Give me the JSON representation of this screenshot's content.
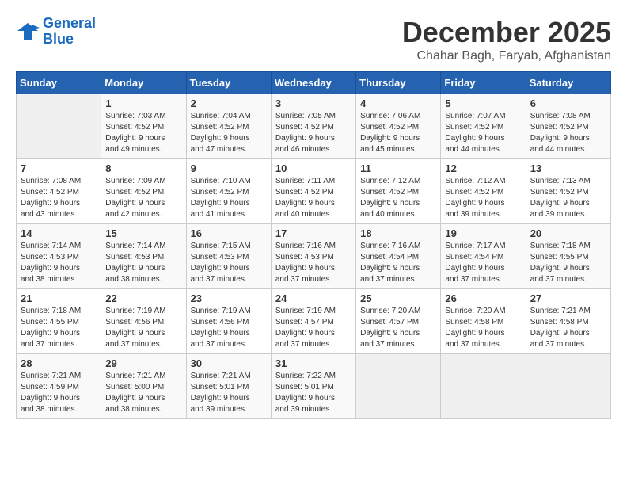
{
  "logo": {
    "line1": "General",
    "line2": "Blue"
  },
  "title": "December 2025",
  "subtitle": "Chahar Bagh, Faryab, Afghanistan",
  "days_header": [
    "Sunday",
    "Monday",
    "Tuesday",
    "Wednesday",
    "Thursday",
    "Friday",
    "Saturday"
  ],
  "weeks": [
    [
      {
        "day": "",
        "info": ""
      },
      {
        "day": "1",
        "info": "Sunrise: 7:03 AM\nSunset: 4:52 PM\nDaylight: 9 hours\nand 49 minutes."
      },
      {
        "day": "2",
        "info": "Sunrise: 7:04 AM\nSunset: 4:52 PM\nDaylight: 9 hours\nand 47 minutes."
      },
      {
        "day": "3",
        "info": "Sunrise: 7:05 AM\nSunset: 4:52 PM\nDaylight: 9 hours\nand 46 minutes."
      },
      {
        "day": "4",
        "info": "Sunrise: 7:06 AM\nSunset: 4:52 PM\nDaylight: 9 hours\nand 45 minutes."
      },
      {
        "day": "5",
        "info": "Sunrise: 7:07 AM\nSunset: 4:52 PM\nDaylight: 9 hours\nand 44 minutes."
      },
      {
        "day": "6",
        "info": "Sunrise: 7:08 AM\nSunset: 4:52 PM\nDaylight: 9 hours\nand 44 minutes."
      }
    ],
    [
      {
        "day": "7",
        "info": "Sunrise: 7:08 AM\nSunset: 4:52 PM\nDaylight: 9 hours\nand 43 minutes."
      },
      {
        "day": "8",
        "info": "Sunrise: 7:09 AM\nSunset: 4:52 PM\nDaylight: 9 hours\nand 42 minutes."
      },
      {
        "day": "9",
        "info": "Sunrise: 7:10 AM\nSunset: 4:52 PM\nDaylight: 9 hours\nand 41 minutes."
      },
      {
        "day": "10",
        "info": "Sunrise: 7:11 AM\nSunset: 4:52 PM\nDaylight: 9 hours\nand 40 minutes."
      },
      {
        "day": "11",
        "info": "Sunrise: 7:12 AM\nSunset: 4:52 PM\nDaylight: 9 hours\nand 40 minutes."
      },
      {
        "day": "12",
        "info": "Sunrise: 7:12 AM\nSunset: 4:52 PM\nDaylight: 9 hours\nand 39 minutes."
      },
      {
        "day": "13",
        "info": "Sunrise: 7:13 AM\nSunset: 4:52 PM\nDaylight: 9 hours\nand 39 minutes."
      }
    ],
    [
      {
        "day": "14",
        "info": "Sunrise: 7:14 AM\nSunset: 4:53 PM\nDaylight: 9 hours\nand 38 minutes."
      },
      {
        "day": "15",
        "info": "Sunrise: 7:14 AM\nSunset: 4:53 PM\nDaylight: 9 hours\nand 38 minutes."
      },
      {
        "day": "16",
        "info": "Sunrise: 7:15 AM\nSunset: 4:53 PM\nDaylight: 9 hours\nand 37 minutes."
      },
      {
        "day": "17",
        "info": "Sunrise: 7:16 AM\nSunset: 4:53 PM\nDaylight: 9 hours\nand 37 minutes."
      },
      {
        "day": "18",
        "info": "Sunrise: 7:16 AM\nSunset: 4:54 PM\nDaylight: 9 hours\nand 37 minutes."
      },
      {
        "day": "19",
        "info": "Sunrise: 7:17 AM\nSunset: 4:54 PM\nDaylight: 9 hours\nand 37 minutes."
      },
      {
        "day": "20",
        "info": "Sunrise: 7:18 AM\nSunset: 4:55 PM\nDaylight: 9 hours\nand 37 minutes."
      }
    ],
    [
      {
        "day": "21",
        "info": "Sunrise: 7:18 AM\nSunset: 4:55 PM\nDaylight: 9 hours\nand 37 minutes."
      },
      {
        "day": "22",
        "info": "Sunrise: 7:19 AM\nSunset: 4:56 PM\nDaylight: 9 hours\nand 37 minutes."
      },
      {
        "day": "23",
        "info": "Sunrise: 7:19 AM\nSunset: 4:56 PM\nDaylight: 9 hours\nand 37 minutes."
      },
      {
        "day": "24",
        "info": "Sunrise: 7:19 AM\nSunset: 4:57 PM\nDaylight: 9 hours\nand 37 minutes."
      },
      {
        "day": "25",
        "info": "Sunrise: 7:20 AM\nSunset: 4:57 PM\nDaylight: 9 hours\nand 37 minutes."
      },
      {
        "day": "26",
        "info": "Sunrise: 7:20 AM\nSunset: 4:58 PM\nDaylight: 9 hours\nand 37 minutes."
      },
      {
        "day": "27",
        "info": "Sunrise: 7:21 AM\nSunset: 4:58 PM\nDaylight: 9 hours\nand 37 minutes."
      }
    ],
    [
      {
        "day": "28",
        "info": "Sunrise: 7:21 AM\nSunset: 4:59 PM\nDaylight: 9 hours\nand 38 minutes."
      },
      {
        "day": "29",
        "info": "Sunrise: 7:21 AM\nSunset: 5:00 PM\nDaylight: 9 hours\nand 38 minutes."
      },
      {
        "day": "30",
        "info": "Sunrise: 7:21 AM\nSunset: 5:01 PM\nDaylight: 9 hours\nand 39 minutes."
      },
      {
        "day": "31",
        "info": "Sunrise: 7:22 AM\nSunset: 5:01 PM\nDaylight: 9 hours\nand 39 minutes."
      },
      {
        "day": "",
        "info": ""
      },
      {
        "day": "",
        "info": ""
      },
      {
        "day": "",
        "info": ""
      }
    ]
  ]
}
